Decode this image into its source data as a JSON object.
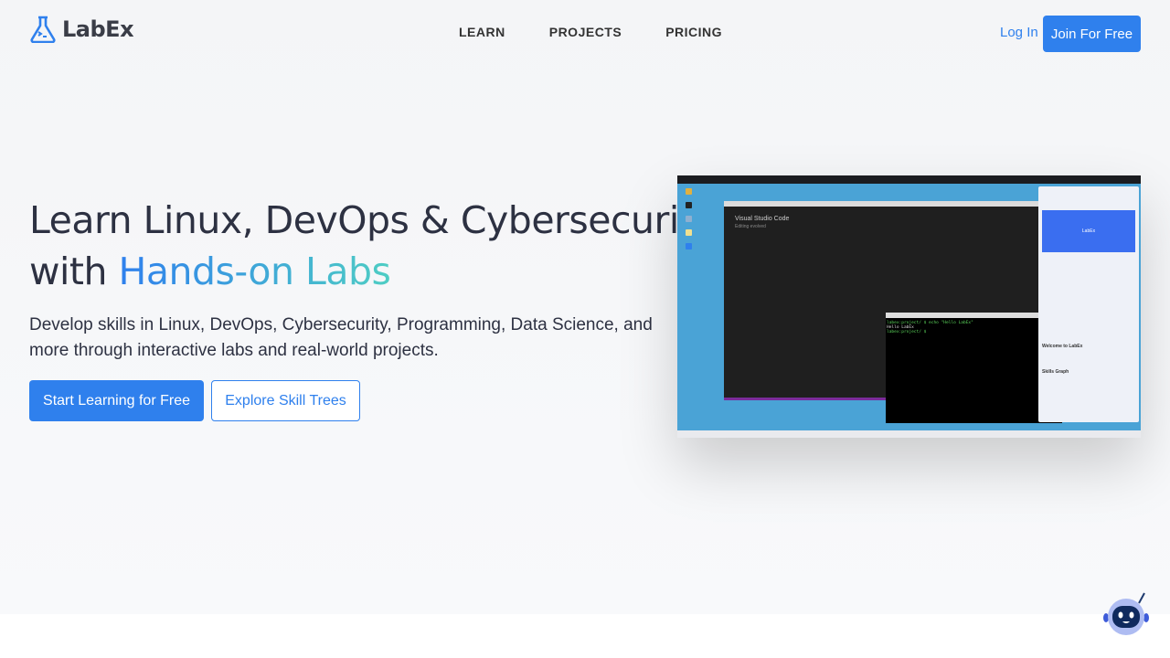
{
  "header": {
    "logo_text": "LabEx",
    "nav": [
      "LEARN",
      "PROJECTS",
      "PRICING"
    ],
    "login": "Log In",
    "join": "Join For Free"
  },
  "hero": {
    "title_line1": "Learn Linux, DevOps & Cybersecurity",
    "title_with": "with ",
    "title_highlight": "Hands-on Labs",
    "subtitle": "Develop skills in Linux, DevOps, Cybersecurity, Programming, Data Science, and more through interactive labs and real-world projects.",
    "primary_button": "Start Learning for Free",
    "secondary_button": "Explore Skill Trees"
  },
  "preview": {
    "vscode_title": "Visual Studio Code",
    "vscode_subtitle": "Editing evolved",
    "terminal_lines": [
      "labex:project/ $ echo \"Hello LabEx\"",
      "Hello LabEx",
      "labex:project/ $ "
    ],
    "video_label": "LabEx",
    "chat_heading": "Welcome to LabEx",
    "chat_subheading": "Skills Graph"
  },
  "colors": {
    "accent": "#2f80ed",
    "gradient_end": "#4ecdc4"
  }
}
